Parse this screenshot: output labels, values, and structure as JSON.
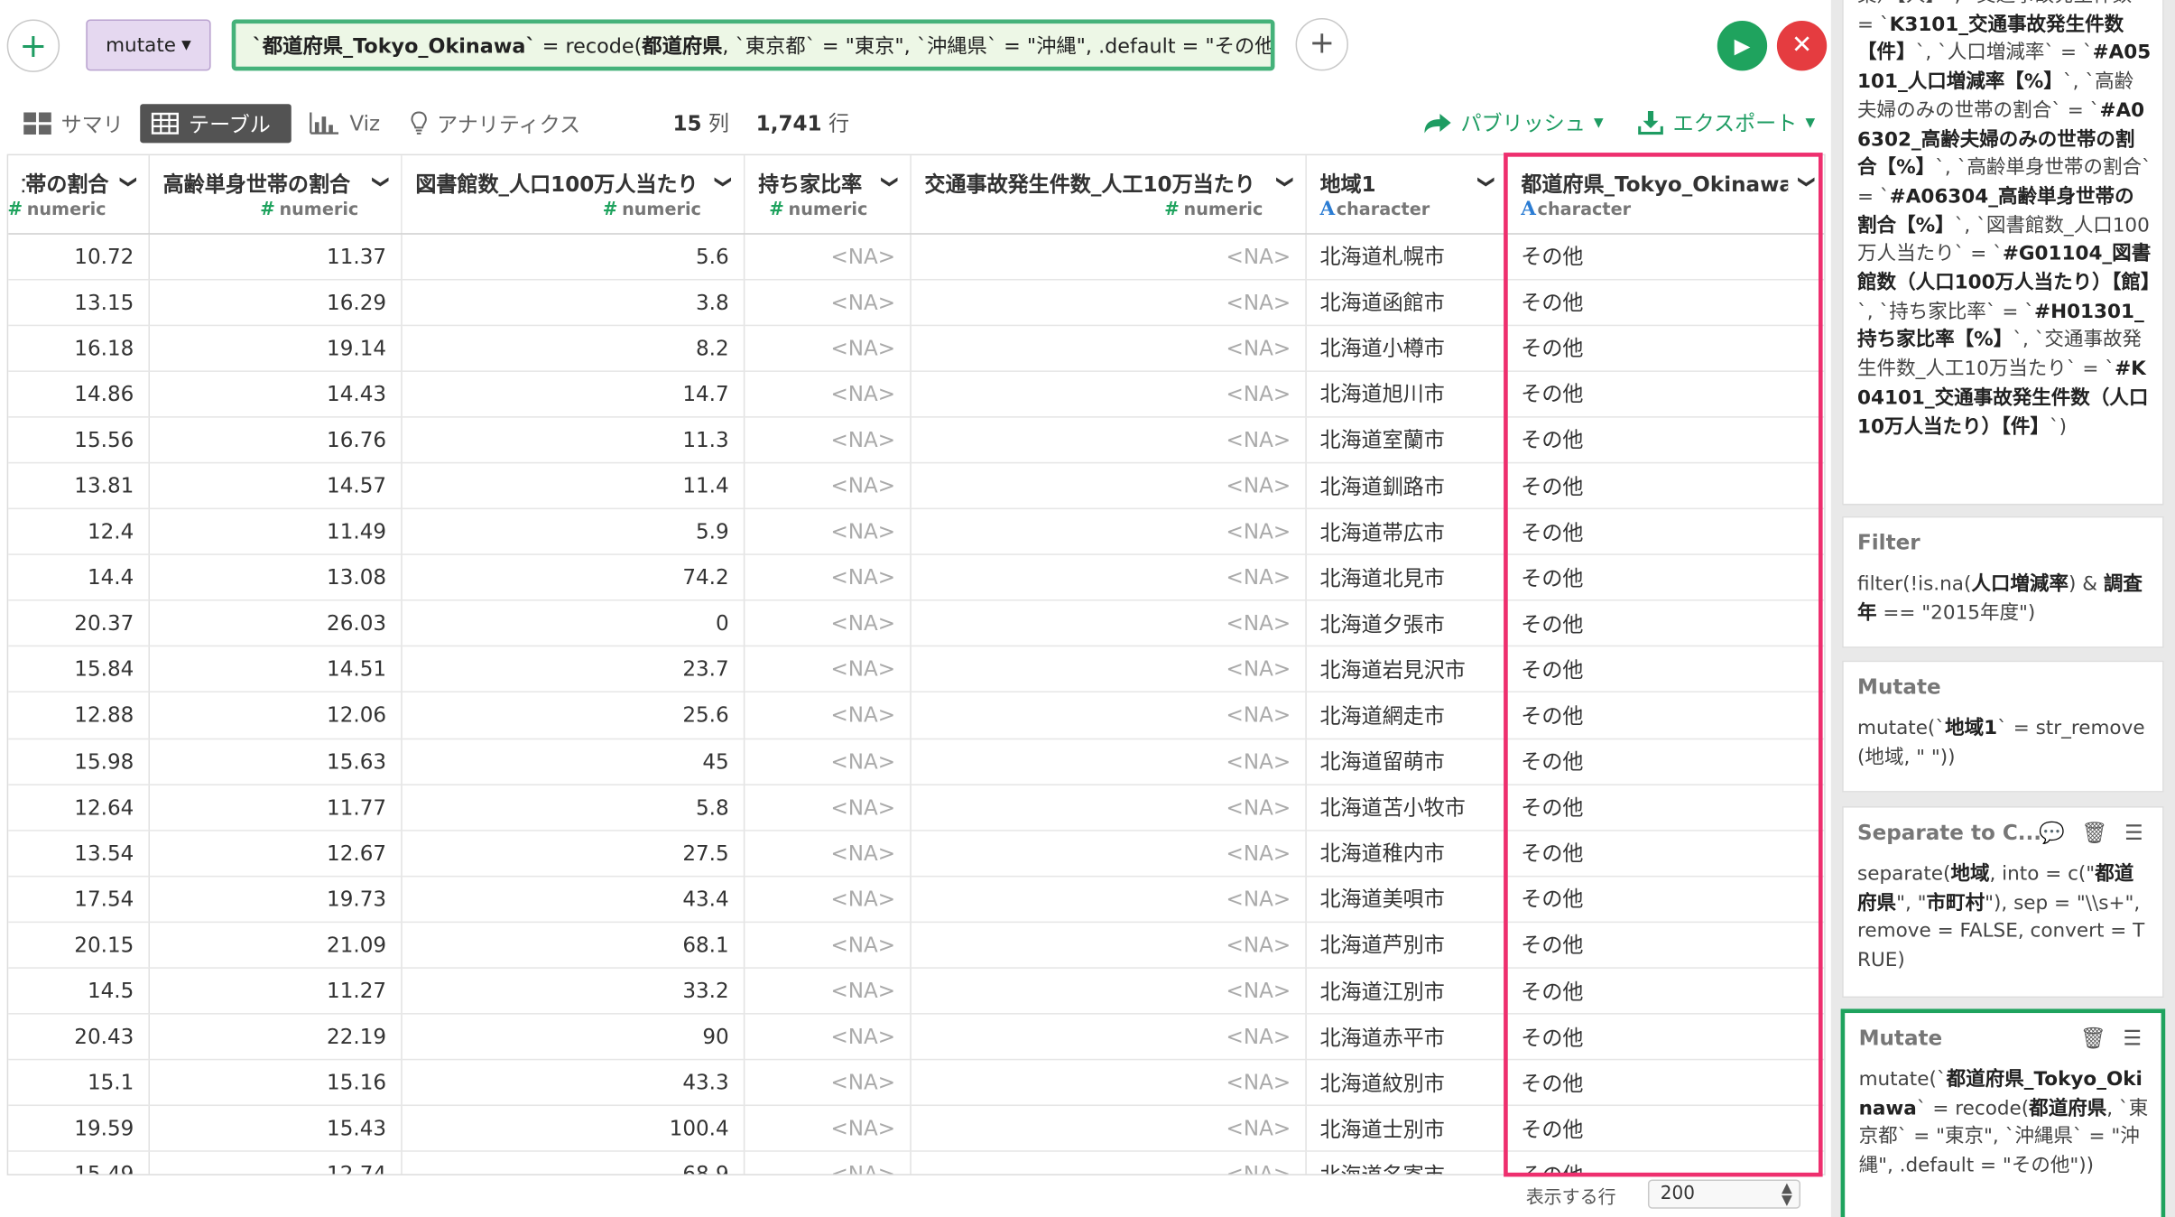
{
  "command": {
    "dropdown_label": "mutate",
    "expression_parts": [
      {
        "t": "`都道府県_Tokyo_Okinawa`",
        "b": true
      },
      {
        "t": " = recode(",
        "b": false
      },
      {
        "t": "都道府県",
        "b": true
      },
      {
        "t": ", `東京都` = \"東京\", `沖縄県` = \"沖縄\", .default = \"その他\")",
        "b": false
      }
    ]
  },
  "views": {
    "summary": "サマリ",
    "table": "テーブル",
    "viz": "Viz",
    "analytics": "アナリティクス"
  },
  "stats": {
    "cols_num": "15",
    "cols_unit": "列",
    "rows_num": "1,741",
    "rows_unit": "行"
  },
  "actions": {
    "publish": "パブリッシュ",
    "export": "エクスポート"
  },
  "table": {
    "columns": [
      {
        "name": "世帯の割合",
        "type": "numeric"
      },
      {
        "name": "高齢単身世帯の割合",
        "type": "numeric"
      },
      {
        "name": "図書館数_人口100万人当たり",
        "type": "numeric"
      },
      {
        "name": "持ち家比率",
        "type": "numeric"
      },
      {
        "name": "交通事故発生件数_人工10万当たり",
        "type": "numeric"
      },
      {
        "name": "地域1",
        "type": "character"
      },
      {
        "name": "都道府県_Tokyo_Okinawa",
        "type": "character"
      }
    ],
    "rows": [
      [
        "10.72",
        "11.37",
        "5.6",
        "<NA>",
        "<NA>",
        "北海道札幌市",
        "その他"
      ],
      [
        "13.15",
        "16.29",
        "3.8",
        "<NA>",
        "<NA>",
        "北海道函館市",
        "その他"
      ],
      [
        "16.18",
        "19.14",
        "8.2",
        "<NA>",
        "<NA>",
        "北海道小樽市",
        "その他"
      ],
      [
        "14.86",
        "14.43",
        "14.7",
        "<NA>",
        "<NA>",
        "北海道旭川市",
        "その他"
      ],
      [
        "15.56",
        "16.76",
        "11.3",
        "<NA>",
        "<NA>",
        "北海道室蘭市",
        "その他"
      ],
      [
        "13.81",
        "14.57",
        "11.4",
        "<NA>",
        "<NA>",
        "北海道釧路市",
        "その他"
      ],
      [
        "12.4",
        "11.49",
        "5.9",
        "<NA>",
        "<NA>",
        "北海道帯広市",
        "その他"
      ],
      [
        "14.4",
        "13.08",
        "74.2",
        "<NA>",
        "<NA>",
        "北海道北見市",
        "その他"
      ],
      [
        "20.37",
        "26.03",
        "0",
        "<NA>",
        "<NA>",
        "北海道夕張市",
        "その他"
      ],
      [
        "15.84",
        "14.51",
        "23.7",
        "<NA>",
        "<NA>",
        "北海道岩見沢市",
        "その他"
      ],
      [
        "12.88",
        "12.06",
        "25.6",
        "<NA>",
        "<NA>",
        "北海道網走市",
        "その他"
      ],
      [
        "15.98",
        "15.63",
        "45",
        "<NA>",
        "<NA>",
        "北海道留萌市",
        "その他"
      ],
      [
        "12.64",
        "11.77",
        "5.8",
        "<NA>",
        "<NA>",
        "北海道苫小牧市",
        "その他"
      ],
      [
        "13.54",
        "12.67",
        "27.5",
        "<NA>",
        "<NA>",
        "北海道稚内市",
        "その他"
      ],
      [
        "17.54",
        "19.73",
        "43.4",
        "<NA>",
        "<NA>",
        "北海道美唄市",
        "その他"
      ],
      [
        "20.15",
        "21.09",
        "68.1",
        "<NA>",
        "<NA>",
        "北海道芦別市",
        "その他"
      ],
      [
        "14.5",
        "11.27",
        "33.2",
        "<NA>",
        "<NA>",
        "北海道江別市",
        "その他"
      ],
      [
        "20.43",
        "22.19",
        "90",
        "<NA>",
        "<NA>",
        "北海道赤平市",
        "その他"
      ],
      [
        "15.1",
        "15.16",
        "43.3",
        "<NA>",
        "<NA>",
        "北海道紋別市",
        "その他"
      ],
      [
        "19.59",
        "15.43",
        "100.4",
        "<NA>",
        "<NA>",
        "北海道士別市",
        "その他"
      ],
      [
        "15.49",
        "12.74",
        "68.9",
        "<NA>",
        "<NA>",
        "北海道名寄市",
        "その他"
      ]
    ]
  },
  "footer": {
    "rows_label": "表示する行",
    "rows_value": "200"
  },
  "steps": [
    {
      "title": "",
      "body": [
        {
          "t": "業）【人】`, `交通事故発生件数` = `",
          "b": false
        },
        {
          "t": "K3101_交通事故発生件数【件】",
          "b": true
        },
        {
          "t": "`, `人口増減率` = `",
          "b": false
        },
        {
          "t": "#A05101_人口増減率【%】",
          "b": true
        },
        {
          "t": "`, `高齢夫婦のみの世帯の割合` = `",
          "b": false
        },
        {
          "t": "#A06302_高齢夫婦のみの世帯の割合【%】",
          "b": true
        },
        {
          "t": "`, `高齢単身世帯の割合` = `",
          "b": false
        },
        {
          "t": "#A06304_高齢単身世帯の割合【%】",
          "b": true
        },
        {
          "t": "`, `図書館数_人口100万人当たり` = `",
          "b": false
        },
        {
          "t": "#G01104_図書館数（人口100万人当たり）【館】",
          "b": true
        },
        {
          "t": "`, `持ち家比率` = `",
          "b": false
        },
        {
          "t": "#H01301_持ち家比率【%】",
          "b": true
        },
        {
          "t": "`, `交通事故発生件数_人工10万当たり` = `",
          "b": false
        },
        {
          "t": "#K04101_交通事故発生件数（人口10万人当たり）【件】",
          "b": true
        },
        {
          "t": "`)",
          "b": false
        }
      ]
    },
    {
      "title": "Filter",
      "body": [
        {
          "t": "filter(!is.na(",
          "b": false
        },
        {
          "t": "人口増減率",
          "b": true
        },
        {
          "t": ") & ",
          "b": false
        },
        {
          "t": "調査年",
          "b": true
        },
        {
          "t": " == \"2015年度\")",
          "b": false
        }
      ]
    },
    {
      "title": "Mutate",
      "body": [
        {
          "t": "mutate(`",
          "b": false
        },
        {
          "t": "地域1",
          "b": true
        },
        {
          "t": "` = str_remove(地域, \" \"))",
          "b": false
        }
      ]
    },
    {
      "title": "Separate to C...",
      "body": [
        {
          "t": "separate(",
          "b": false
        },
        {
          "t": "地域",
          "b": true
        },
        {
          "t": ", into = c(\"",
          "b": false
        },
        {
          "t": "都道府県",
          "b": true
        },
        {
          "t": "\", \"",
          "b": false
        },
        {
          "t": "市町村",
          "b": true
        },
        {
          "t": "\"), sep = \"\\\\s+\", remove = FALSE, convert = TRUE)",
          "b": false
        }
      ]
    },
    {
      "title": "Mutate",
      "body": [
        {
          "t": "mutate(`",
          "b": false
        },
        {
          "t": "都道府県_Tokyo_Okinawa",
          "b": true
        },
        {
          "t": "` = recode(",
          "b": false
        },
        {
          "t": "都道府県",
          "b": true
        },
        {
          "t": ", `東京都` = \"東京\", `沖縄県` = \"沖縄\", .default = \"その他\"))",
          "b": false
        }
      ]
    }
  ],
  "colors": {
    "accent_green": "#1fa35e",
    "highlight_pink": "#ee2f6e",
    "active_tab": "#535353",
    "danger_red": "#e53c40"
  }
}
